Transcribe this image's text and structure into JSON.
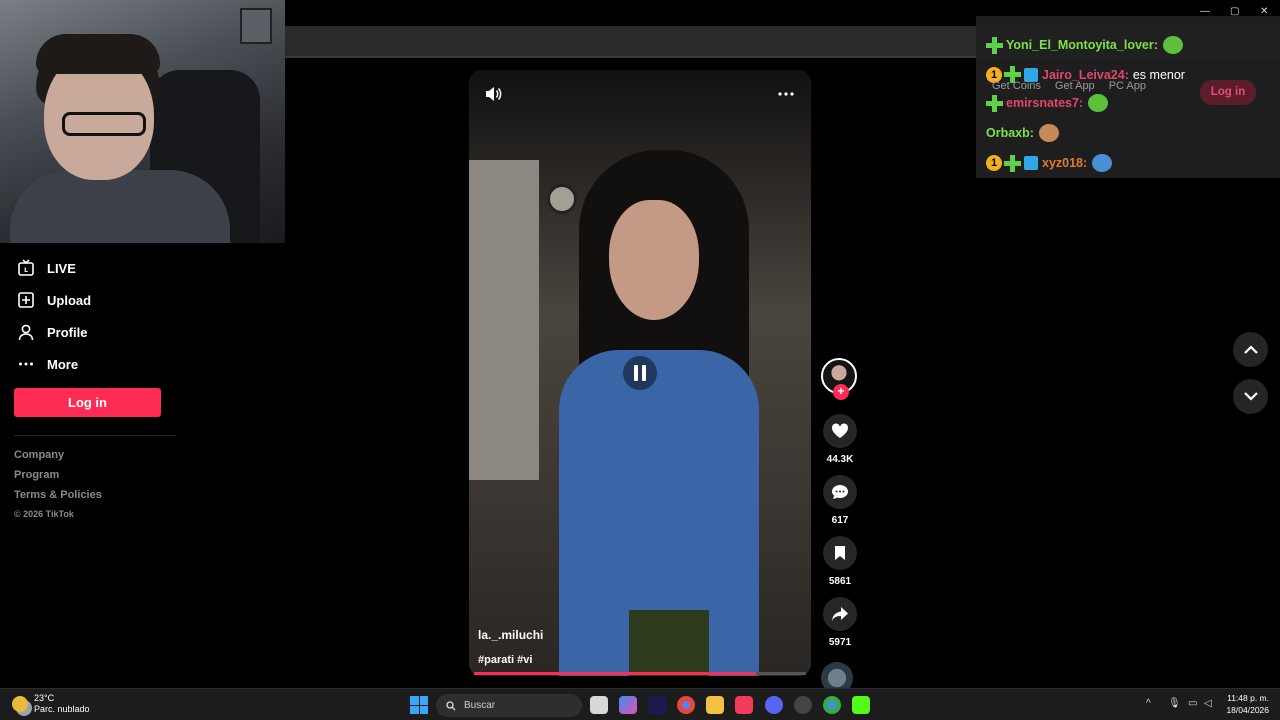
{
  "nav": {
    "items": [
      {
        "label": "LIVE",
        "icon": "live-icon"
      },
      {
        "label": "Upload",
        "icon": "upload-icon"
      },
      {
        "label": "Profile",
        "icon": "profile-icon"
      },
      {
        "label": "More",
        "icon": "more-icon"
      }
    ],
    "login_label": "Log in"
  },
  "footer": {
    "links": [
      "Company",
      "Program",
      "Terms & Policies"
    ],
    "copyright": "© 2026 TikTok"
  },
  "video": {
    "author": "la._.miluchi",
    "tags": "#parati #vi",
    "progress_fraction": 0.85
  },
  "actions": {
    "likes": "44.3K",
    "comments": "617",
    "saves": "5861",
    "shares": "5971"
  },
  "chat": {
    "lines": [
      {
        "user": "Yoni_El_Montoyita_lover:",
        "message": "",
        "user_color": "#7ee04a"
      },
      {
        "user": "Jairo_Leiva24:",
        "message": "es menor",
        "user_color": "#e0476d"
      },
      {
        "user": "emirsnates7:",
        "message": "",
        "user_color": "#e0476d"
      },
      {
        "user": "Orbaxb:",
        "message": "",
        "user_color": "#7ee04a"
      },
      {
        "user": "xyz018:",
        "message": "",
        "user_color": "#e07a30"
      }
    ],
    "gold_badge": "1"
  },
  "tiktok_topbar": {
    "get_coins": "Get Coins",
    "get_app": "Get App",
    "pc_app": "PC App",
    "login_label": "Log in"
  },
  "taskbar": {
    "weather_temp": "23°C",
    "weather_desc": "Parc. nublado",
    "search_placeholder": "Buscar",
    "time": "11:48 p. m.",
    "date": "18/04/2026"
  },
  "colors": {
    "accent": "#fe2c55",
    "chat_green": "#7ee04a"
  }
}
